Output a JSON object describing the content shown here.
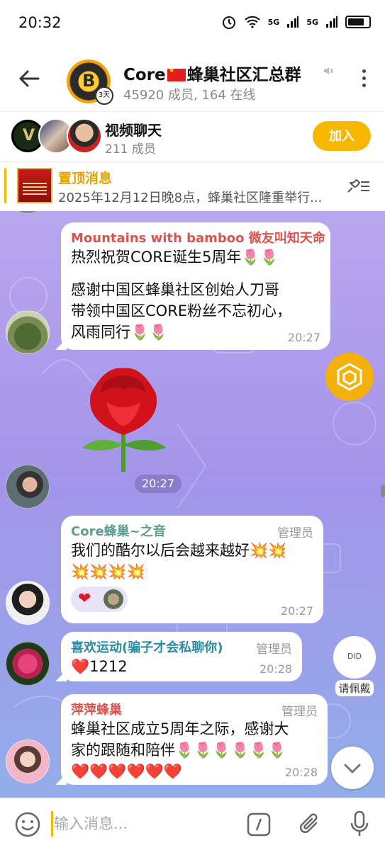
{
  "status": {
    "time": "20:32",
    "network_labels": [
      "5G",
      "5G"
    ]
  },
  "header": {
    "title_before_flag": "Core",
    "title_after_flag": "蜂巢社区汇总群",
    "meta": "45920 成员, 164 在线",
    "avatar_badge": "3天",
    "icons": [
      "back-arrow-icon",
      "mute-icon",
      "more-vertical-icon"
    ]
  },
  "video_chat": {
    "title": "视频聊天",
    "count": "211 成员",
    "join_label": "加入"
  },
  "pinned": {
    "title": "置顶消息",
    "text": "2025年12月12日晚8点，蜂巢社区隆重举行...",
    "icon": "unpin-list-icon"
  },
  "messages": [
    {
      "sender": "Mountains with bamboo 微友叫知天命",
      "sender_color": "#d9534f",
      "lines": [
        "热烈祝贺CORE诞生5周年🌷🌷",
        "",
        "感谢中国区蜂巢社区创始人刀哥",
        "带领中国区CORE粉丝不忘初心，",
        "风雨同行🌷🌷"
      ],
      "time": "20:27"
    },
    {
      "sticker": "rose",
      "time": "20:27"
    },
    {
      "sender": "Core蜂巢~之音",
      "sender_color": "#5c9e8f",
      "role": "管理员",
      "lines": [
        "我们的酷尔以后会越来越好💥💥",
        "💥💥💥💥"
      ],
      "reaction": "❤",
      "time": "20:27"
    },
    {
      "sender": "喜欢运动(骗子才会私聊你)",
      "sender_color": "#2a8ca3",
      "role": "管理员",
      "lines": [
        "❤️1212"
      ],
      "time": "20:28"
    },
    {
      "sender": "萍萍蜂巢",
      "sender_color": "#d9534f",
      "role": "管理员",
      "lines": [
        "蜂巢社区成立5周年之际，感谢大",
        "家的跟随和陪伴🌷🌷🌷🌷🌷🌷",
        "❤️❤️❤️❤️❤️❤️"
      ],
      "time": "20:28"
    }
  ],
  "floating": {
    "did_badge": "DID",
    "did_label": "请佩戴"
  },
  "input": {
    "placeholder": "输入消息...",
    "icons": [
      "emoji-icon",
      "command-icon",
      "attach-icon",
      "microphone-icon"
    ]
  },
  "colors": {
    "accent": "#f7b600",
    "chat_bg_top": "#b9a6ee",
    "chat_bg_bottom": "#93aeea"
  }
}
